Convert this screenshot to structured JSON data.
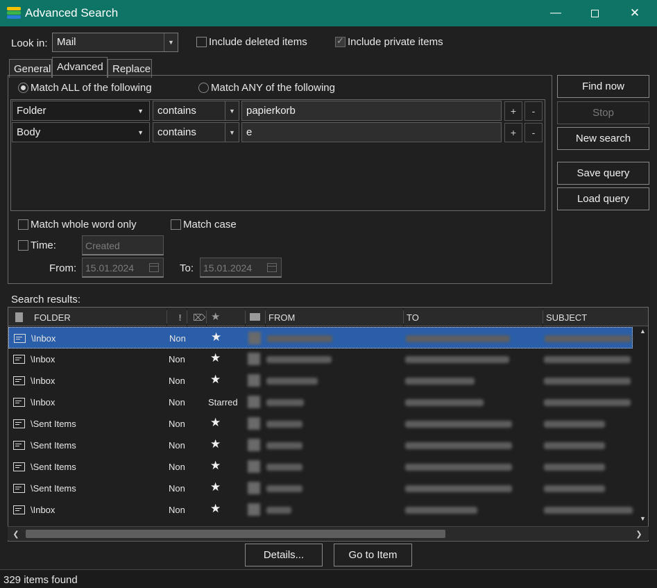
{
  "window": {
    "title": "Advanced Search",
    "title_bar_color": "#0e7566",
    "icons": [
      "minimize-icon",
      "maximize-icon",
      "close-icon"
    ]
  },
  "lookin": {
    "label": "Look in:",
    "value": "Mail",
    "include_deleted_label": "Include deleted items",
    "include_deleted_checked": false,
    "include_private_label": "Include private items",
    "include_private_checked": true
  },
  "tabs": [
    {
      "label": "General",
      "active": false
    },
    {
      "label": "Advanced",
      "active": true
    },
    {
      "label": "Replace",
      "active": false
    }
  ],
  "match": {
    "all_label": "Match ALL of the following",
    "any_label": "Match ANY of the following",
    "selected": "all"
  },
  "conditions": [
    {
      "field": "Folder",
      "operator": "contains",
      "value": "papierkorb"
    },
    {
      "field": "Body",
      "operator": "contains",
      "value": "e"
    }
  ],
  "condition_buttons": {
    "add": "+",
    "remove": "-"
  },
  "options": {
    "whole_word_label": "Match whole word only",
    "match_case_label": "Match case",
    "time_label": "Time:",
    "time_value": "Created",
    "from_label": "From:",
    "from_value": "15.01.2024",
    "to_label": "To:",
    "to_value": "15.01.2024"
  },
  "buttons": {
    "find_now": "Find now",
    "stop": "Stop",
    "new_search": "New search",
    "save_query": "Save query",
    "load_query": "Load query",
    "details": "Details...",
    "go_to_item": "Go to Item"
  },
  "results": {
    "label": "Search results:",
    "columns": [
      "FOLDER",
      "!",
      "FROM",
      "TO",
      "SUBJECT"
    ],
    "rows": [
      {
        "folder": "\\Inbox",
        "importance": "Non",
        "flag": "★",
        "selected": true
      },
      {
        "folder": "\\Inbox",
        "importance": "Non",
        "flag": "★",
        "selected": false
      },
      {
        "folder": "\\Inbox",
        "importance": "Non",
        "flag": "★",
        "selected": false
      },
      {
        "folder": "\\Inbox",
        "importance": "Non",
        "flag": "Starred",
        "selected": false
      },
      {
        "folder": "\\Sent Items",
        "importance": "Non",
        "flag": "★",
        "selected": false
      },
      {
        "folder": "\\Sent Items",
        "importance": "Non",
        "flag": "★",
        "selected": false
      },
      {
        "folder": "\\Sent Items",
        "importance": "Non",
        "flag": "★",
        "selected": false
      },
      {
        "folder": "\\Sent Items",
        "importance": "Non",
        "flag": "★",
        "selected": false
      },
      {
        "folder": "\\Inbox",
        "importance": "Non",
        "flag": "★",
        "selected": false
      }
    ]
  },
  "status": {
    "count_text": "329 items found"
  },
  "colors": {
    "selection": "#2a5ea8",
    "background": "#202020"
  }
}
